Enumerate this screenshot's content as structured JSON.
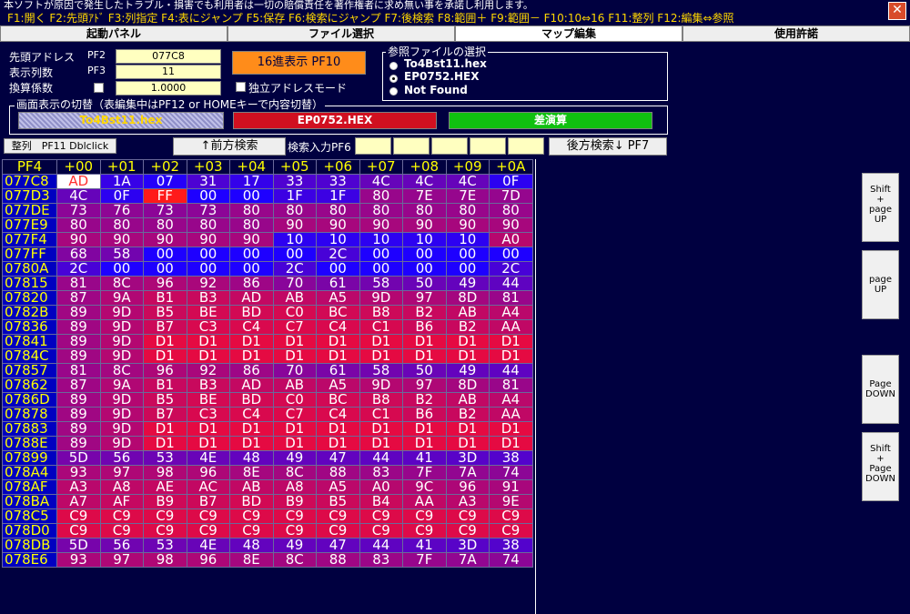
{
  "window": {
    "disclaimer": "本ソフトが原因で発生したトラブル・損害でも利用者は一切の賠償責任を著作権者に求め無い事を承諾し利用します。",
    "fkeys": "F1:開く F2:先頭ｱﾄﾞ F3:列指定 F4:表にジャンプ F5:保存 F6:検索にジャンプ F7:後検索 F8:範囲＋ F9:範囲－ F10:10⇔16 F11:整列 F12:編集⇔参照",
    "close": "✕"
  },
  "tabs": [
    {
      "label": "起動パネル"
    },
    {
      "label": "ファイル選択"
    },
    {
      "label": "マップ編集"
    },
    {
      "label": "使用許諾"
    }
  ],
  "controls": {
    "start_addr_label": "先頭アドレス",
    "start_addr_key": "PF2",
    "start_addr_value": "077C8",
    "cols_label": "表示列数",
    "cols_key": "PF3",
    "cols_value": "11",
    "coef_label": "換算係数",
    "coef_value": "1.0000",
    "hex_button": "16進表示 PF10",
    "indep_label": "独立アドレスモード"
  },
  "ref_files": {
    "title": "参照ファイルの選択",
    "options": [
      {
        "label": "To4Bst11.hex",
        "selected": false
      },
      {
        "label": "EP0752.HEX",
        "selected": true
      },
      {
        "label": "Not Found",
        "selected": false
      }
    ]
  },
  "display_switch": {
    "title": "画面表示の切替（表編集中はPF12 or HOMEキーで内容切替）",
    "btn1": "To4Bst11.hex",
    "btn2": "EP0752.HEX",
    "btn3": "差演算",
    "colors": {
      "btn2": "#d01020",
      "btn3": "#10c010"
    }
  },
  "search": {
    "align_label": "整列　PF11 Dblclick",
    "prev_button": "↑前方検索",
    "input_label": "検索入力PF6",
    "next_button": "後方検索↓ PF7"
  },
  "side_buttons": [
    "Shift\n+\npage\nUP",
    "page\nUP",
    "Page\nDOWN",
    "Shift\n+\nPage\nDOWN"
  ],
  "grid": {
    "corner": "PF4",
    "cols": [
      "+00",
      "+01",
      "+02",
      "+03",
      "+04",
      "+05",
      "+06",
      "+07",
      "+08",
      "+09",
      "+0A"
    ],
    "rows": [
      {
        "addr": "077C8",
        "cells": [
          "AD",
          "1A",
          "07",
          "31",
          "17",
          "33",
          "33",
          "4C",
          "4C",
          "4C",
          "0F"
        ]
      },
      {
        "addr": "077D3",
        "cells": [
          "4C",
          "0F",
          "FF",
          "00",
          "00",
          "1F",
          "1F",
          "80",
          "7E",
          "7E",
          "7D"
        ]
      },
      {
        "addr": "077DE",
        "cells": [
          "73",
          "76",
          "73",
          "73",
          "80",
          "80",
          "80",
          "80",
          "80",
          "80",
          "80"
        ]
      },
      {
        "addr": "077E9",
        "cells": [
          "80",
          "80",
          "80",
          "80",
          "80",
          "90",
          "90",
          "90",
          "90",
          "90",
          "90"
        ]
      },
      {
        "addr": "077F4",
        "cells": [
          "90",
          "90",
          "90",
          "90",
          "90",
          "10",
          "10",
          "10",
          "10",
          "10",
          "A0"
        ]
      },
      {
        "addr": "077FF",
        "cells": [
          "68",
          "58",
          "00",
          "00",
          "00",
          "00",
          "2C",
          "00",
          "00",
          "00",
          "00"
        ]
      },
      {
        "addr": "0780A",
        "cells": [
          "2C",
          "00",
          "00",
          "00",
          "00",
          "2C",
          "00",
          "00",
          "00",
          "00",
          "2C"
        ]
      },
      {
        "addr": "07815",
        "cells": [
          "81",
          "8C",
          "96",
          "92",
          "86",
          "70",
          "61",
          "58",
          "50",
          "49",
          "44"
        ]
      },
      {
        "addr": "07820",
        "cells": [
          "87",
          "9A",
          "B1",
          "B3",
          "AD",
          "AB",
          "A5",
          "9D",
          "97",
          "8D",
          "81"
        ]
      },
      {
        "addr": "0782B",
        "cells": [
          "89",
          "9D",
          "B5",
          "BE",
          "BD",
          "C0",
          "BC",
          "B8",
          "B2",
          "AB",
          "A4"
        ]
      },
      {
        "addr": "07836",
        "cells": [
          "89",
          "9D",
          "B7",
          "C3",
          "C4",
          "C7",
          "C4",
          "C1",
          "B6",
          "B2",
          "AA"
        ]
      },
      {
        "addr": "07841",
        "cells": [
          "89",
          "9D",
          "D1",
          "D1",
          "D1",
          "D1",
          "D1",
          "D1",
          "D1",
          "D1",
          "D1"
        ]
      },
      {
        "addr": "0784C",
        "cells": [
          "89",
          "9D",
          "D1",
          "D1",
          "D1",
          "D1",
          "D1",
          "D1",
          "D1",
          "D1",
          "D1"
        ]
      },
      {
        "addr": "07857",
        "cells": [
          "81",
          "8C",
          "96",
          "92",
          "86",
          "70",
          "61",
          "58",
          "50",
          "49",
          "44"
        ]
      },
      {
        "addr": "07862",
        "cells": [
          "87",
          "9A",
          "B1",
          "B3",
          "AD",
          "AB",
          "A5",
          "9D",
          "97",
          "8D",
          "81"
        ]
      },
      {
        "addr": "0786D",
        "cells": [
          "89",
          "9D",
          "B5",
          "BE",
          "BD",
          "C0",
          "BC",
          "B8",
          "B2",
          "AB",
          "A4"
        ]
      },
      {
        "addr": "07878",
        "cells": [
          "89",
          "9D",
          "B7",
          "C3",
          "C4",
          "C7",
          "C4",
          "C1",
          "B6",
          "B2",
          "AA"
        ]
      },
      {
        "addr": "07883",
        "cells": [
          "89",
          "9D",
          "D1",
          "D1",
          "D1",
          "D1",
          "D1",
          "D1",
          "D1",
          "D1",
          "D1"
        ]
      },
      {
        "addr": "0788E",
        "cells": [
          "89",
          "9D",
          "D1",
          "D1",
          "D1",
          "D1",
          "D1",
          "D1",
          "D1",
          "D1",
          "D1"
        ]
      },
      {
        "addr": "07899",
        "cells": [
          "5D",
          "56",
          "53",
          "4E",
          "48",
          "49",
          "47",
          "44",
          "41",
          "3D",
          "38"
        ]
      },
      {
        "addr": "078A4",
        "cells": [
          "93",
          "97",
          "98",
          "96",
          "8E",
          "8C",
          "88",
          "83",
          "7F",
          "7A",
          "74"
        ]
      },
      {
        "addr": "078AF",
        "cells": [
          "A3",
          "A8",
          "AE",
          "AC",
          "AB",
          "A8",
          "A5",
          "A0",
          "9C",
          "96",
          "91"
        ]
      },
      {
        "addr": "078BA",
        "cells": [
          "A7",
          "AF",
          "B9",
          "B7",
          "BD",
          "B9",
          "B5",
          "B4",
          "AA",
          "A3",
          "9E"
        ]
      },
      {
        "addr": "078C5",
        "cells": [
          "C9",
          "C9",
          "C9",
          "C9",
          "C9",
          "C9",
          "C9",
          "C9",
          "C9",
          "C9",
          "C9"
        ]
      },
      {
        "addr": "078D0",
        "cells": [
          "C9",
          "C9",
          "C9",
          "C9",
          "C9",
          "C9",
          "C9",
          "C9",
          "C9",
          "C9",
          "C9"
        ]
      },
      {
        "addr": "078DB",
        "cells": [
          "5D",
          "56",
          "53",
          "4E",
          "48",
          "49",
          "47",
          "44",
          "41",
          "3D",
          "38"
        ]
      },
      {
        "addr": "078E6",
        "cells": [
          "93",
          "97",
          "98",
          "96",
          "8E",
          "8C",
          "88",
          "83",
          "7F",
          "7A",
          "74"
        ]
      }
    ]
  }
}
